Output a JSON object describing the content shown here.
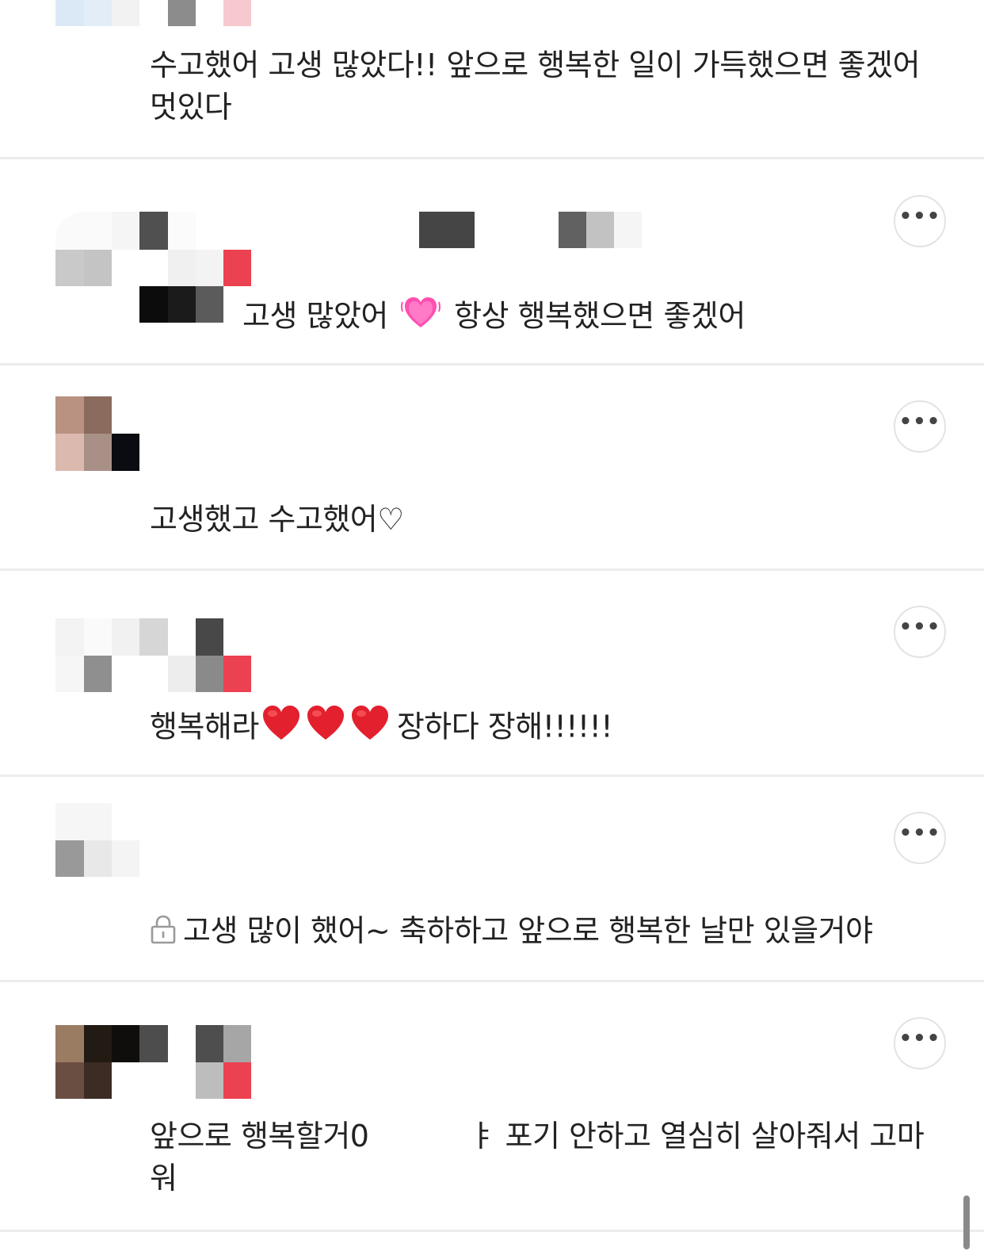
{
  "comments": [
    {
      "text": "수고했어 고생 많았다!! 앞으로 행복한 일이 가득했으면 좋겠어 멋있다"
    },
    {
      "text_a": "고생 많았어",
      "text_b": "항상 행복했으면 좋겠어",
      "emoji": "beating-heart-emoji",
      "more_label": "•••"
    },
    {
      "text": "고생했고 수고했어♡",
      "more_label": "•••"
    },
    {
      "text_a": "행복해라",
      "text_b": "장하다 장해!!!!!!",
      "emoji": "red-heart-emoji",
      "more_label": "•••"
    },
    {
      "text": "고생 많이 했어~ 축하하고 앞으로 행복한 날만 있을거야",
      "icon": "lock-icon",
      "more_label": "•••"
    },
    {
      "text_a": "앞으로 행복할거0",
      "text_b": "ㅑ 포기 안하고 열심히 살아줘서 고마워",
      "more_label": "•••"
    }
  ],
  "colors": {
    "accent_red": "#ec4150",
    "divider": "#ececec",
    "text": "#222222"
  }
}
